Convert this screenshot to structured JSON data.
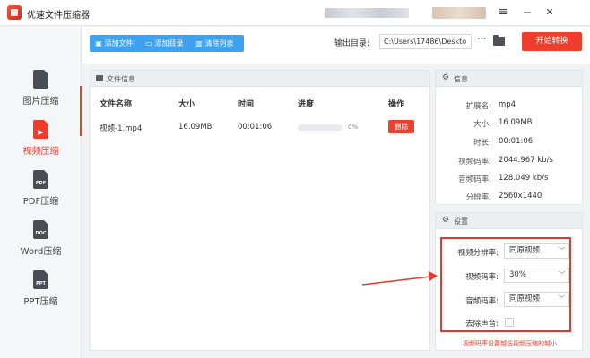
{
  "app": {
    "title": "优速文件压缩器"
  },
  "window_controls": {
    "menu": "≡",
    "minimize": "—",
    "close": "✕"
  },
  "sidebar": {
    "items": [
      {
        "label": "图片压缩",
        "badge": ""
      },
      {
        "label": "视频压缩",
        "badge": ""
      },
      {
        "label": "PDF压缩",
        "badge": "PDF"
      },
      {
        "label": "Word压缩",
        "badge": "DOC"
      },
      {
        "label": "PPT压缩",
        "badge": "PPT"
      }
    ],
    "active_index": 1
  },
  "toolbar": {
    "add_file": "添加文件",
    "add_folder": "添加目录",
    "clear_list": "清除列表",
    "output_label": "输出目录:",
    "output_path": "C:\\Users\\17486\\Deskto",
    "more": "···",
    "start": "开始转换"
  },
  "file_panel": {
    "title": "文件信息",
    "columns": [
      "文件名称",
      "大小",
      "时间",
      "进度",
      "操作"
    ],
    "rows": [
      {
        "name": "视频-1.mp4",
        "size": "16.09MB",
        "time": "00:01:06",
        "progress_pct": 0,
        "progress_label": "0%",
        "action": "删除"
      }
    ]
  },
  "info_panel": {
    "title": "信息",
    "fields": [
      {
        "key": "扩展名:",
        "value": "mp4"
      },
      {
        "key": "大小:",
        "value": "16.09MB"
      },
      {
        "key": "时长:",
        "value": "00:01:06"
      },
      {
        "key": "视频码率:",
        "value": "2044.967 kb/s"
      },
      {
        "key": "音频码率:",
        "value": "128.049 kb/s"
      },
      {
        "key": "分辨率:",
        "value": "2560x1440"
      }
    ]
  },
  "settings_panel": {
    "title": "设置",
    "fields": [
      {
        "key": "视频分辨率:",
        "value": "同原视频"
      },
      {
        "key": "视频码率:",
        "value": "30%"
      },
      {
        "key": "音频码率:",
        "value": "同原视频"
      }
    ],
    "remove_audio_label": "去除声音:",
    "remove_audio_checked": false,
    "note": "视频码率设置越低视频压缩的越小"
  },
  "colors": {
    "accent": "#ef3e2b",
    "toolbar_blue": "#3ea2f1",
    "highlight": "#e23a2a"
  }
}
